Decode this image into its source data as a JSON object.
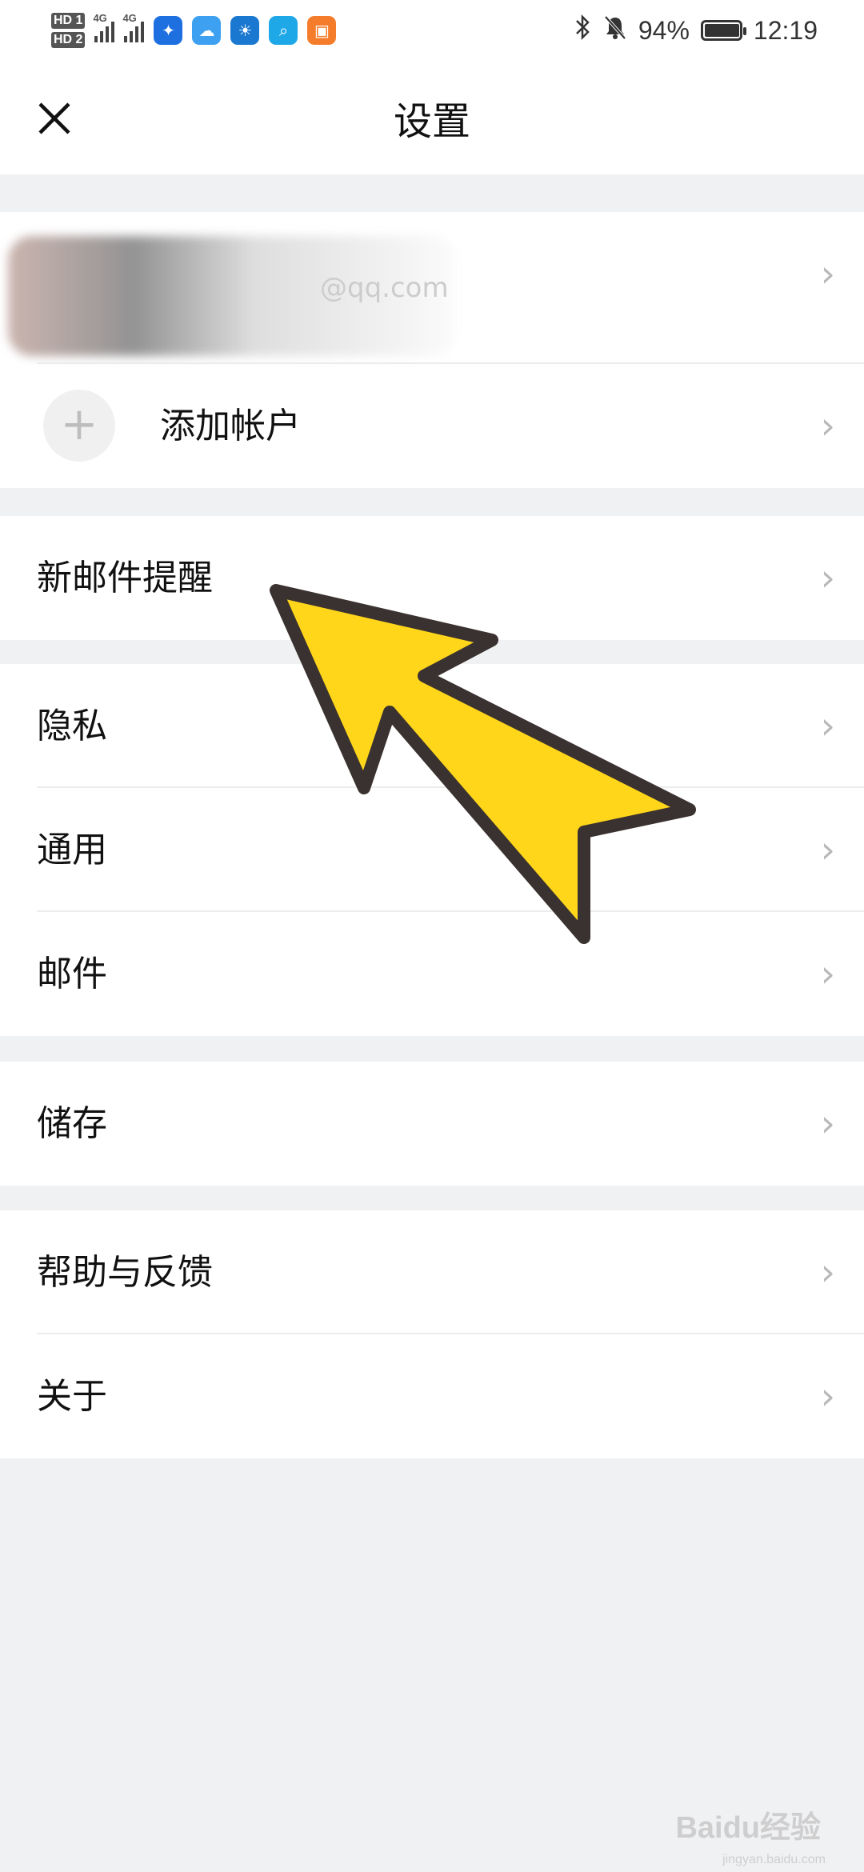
{
  "status_bar": {
    "sim1": "HD 1",
    "sim2": "HD 2",
    "network1": "4G",
    "network2": "4G",
    "battery_percent": "94%",
    "battery_level": 0.94,
    "time": "12:19",
    "icons": [
      "bluetooth-icon",
      "mute-icon",
      "battery-icon"
    ],
    "app_icons": [
      {
        "name": "bulb-app-icon",
        "color": "#1e6fe0"
      },
      {
        "name": "cloud-app-icon",
        "color": "#3ea0f0"
      },
      {
        "name": "weather-app-icon",
        "color": "#1b78d0"
      },
      {
        "name": "search-app-icon",
        "color": "#1fa8e8"
      },
      {
        "name": "game-app-icon",
        "color": "#f57c2a"
      }
    ]
  },
  "header": {
    "title": "设置",
    "close_icon": "close-icon"
  },
  "account": {
    "email": "@qq.com"
  },
  "add_account": {
    "label": "添加帐户",
    "icon": "+"
  },
  "menu": {
    "new_mail_alert": "新邮件提醒",
    "privacy": "隐私",
    "general": "通用",
    "mail": "邮件",
    "storage": "储存",
    "help_feedback": "帮助与反馈",
    "about": "关于",
    "chevron": "›"
  },
  "colors": {
    "background": "#f0f1f3",
    "surface": "#ffffff",
    "arrow_fill": "#ffd61a",
    "arrow_stroke": "#3a3230"
  },
  "watermark": {
    "brand": "Baidu经验",
    "url": "jingyan.baidu.com"
  }
}
